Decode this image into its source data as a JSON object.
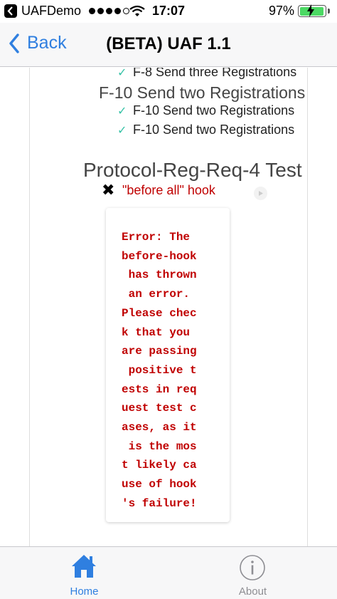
{
  "status_bar": {
    "carrier": "UAFDemo",
    "time": "17:07",
    "battery_percent": "97%",
    "battery_level": 0.97,
    "icons": [
      "back-to-app-icon",
      "signal-dots-icon",
      "wifi-icon",
      "battery-charging-icon"
    ]
  },
  "nav": {
    "back_label": "Back",
    "title": "(BETA) UAF 1.1"
  },
  "tests": {
    "passed_items": [
      "F-8 Send three Registrations",
      "F-10 Send two Registrations",
      "F-10 Send two Registrations"
    ],
    "f10_suite_title": "F-10 Send two Registrations",
    "failed_suite_title": "Protocol-Reg-Req-4 Test",
    "failed_hook_title": "\"before all\" hook",
    "error_message": "Error: The\nbefore-hook\n has thrown\n an error.\nPlease chec\nk that you\nare passing\n positive t\nests in req\nuest test c\nases, as it\n is the mos\nt likely ca\nuse of hook\n's failure!"
  },
  "tab_bar": {
    "home_label": "Home",
    "about_label": "About"
  },
  "colors": {
    "accent": "#2f7fe0",
    "error": "#c00000",
    "pass": "#36c2a6",
    "battery": "#4cd964"
  }
}
